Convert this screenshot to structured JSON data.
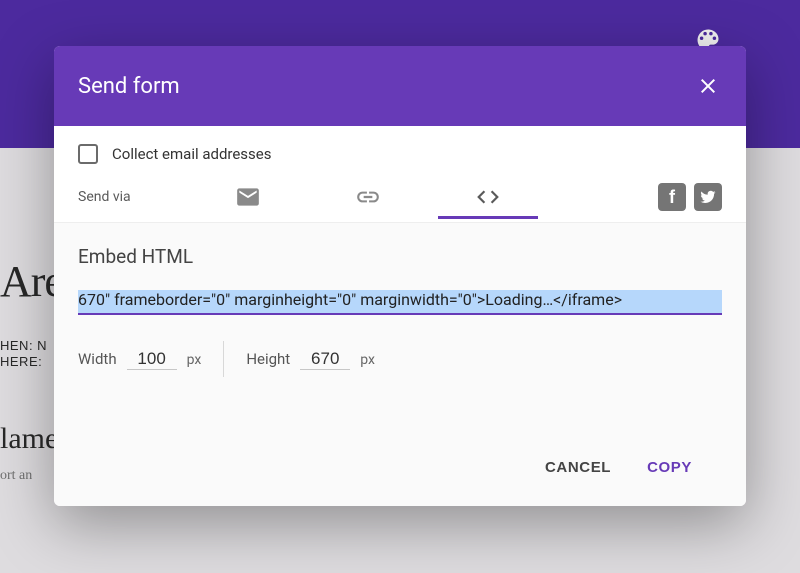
{
  "colors": {
    "accent": "#673ab7",
    "headerDark": "#512da8"
  },
  "background": {
    "title": "Are",
    "line1": "HEN: N",
    "line2": "HERE:",
    "name": "lame",
    "short": "ort an"
  },
  "dialog": {
    "title": "Send form",
    "collect_checkbox_label": "Collect email addresses",
    "collect_checked": false,
    "sendvia_label": "Send via",
    "tabs": {
      "email": "email-icon",
      "link": "link-icon",
      "embed": "code-icon",
      "active": "embed"
    },
    "social": {
      "facebook": "f",
      "twitter": "twitter"
    },
    "embed": {
      "heading": "Embed HTML",
      "code": "670\" frameborder=\"0\" marginheight=\"0\" marginwidth=\"0\">Loading…</iframe>",
      "width_label": "Width",
      "width_value": "100",
      "height_label": "Height",
      "height_value": "670",
      "unit": "px"
    },
    "actions": {
      "cancel": "CANCEL",
      "copy": "COPY"
    }
  }
}
